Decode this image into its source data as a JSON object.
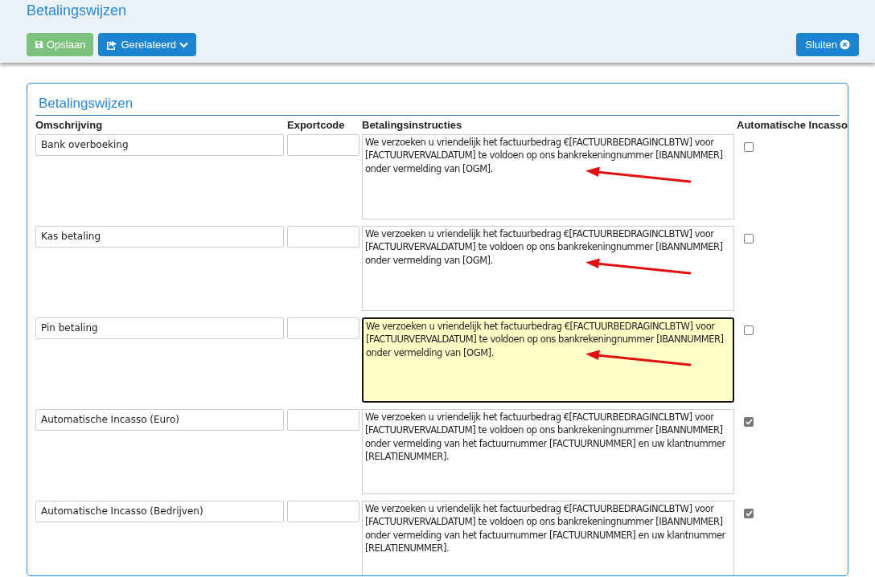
{
  "header": {
    "title": "Betalingswijzen",
    "buttons": [
      {
        "kind": "save",
        "label": "Opslaan",
        "disabled": true
      },
      {
        "kind": "related",
        "label": "Gerelateerd"
      }
    ],
    "close_button": {
      "label": "Sluiten"
    }
  },
  "panel": {
    "title": "Betalingswijzen",
    "columns": [
      "Omschrijving",
      "Exportcode",
      "Betalingsinstructies",
      "Automatische Incasso"
    ],
    "rows": [
      {
        "description": "Bank overboeking",
        "export_code": "",
        "instructions": "We verzoeken u vriendelijk het factuurbedrag €[FACTUURBEDRAGINCLBTW] voor [FACTUURVERVALDATUM] te voldoen op ons bankrekeningnummer [IBANNUMMER] onder vermelding van [OGM].",
        "focused": false,
        "checked": false,
        "arrow": true
      },
      {
        "description": "Kas betaling",
        "export_code": "",
        "instructions": "We verzoeken u vriendelijk het factuurbedrag €[FACTUURBEDRAGINCLBTW] voor [FACTUURVERVALDATUM] te voldoen op ons bankrekeningnummer [IBANNUMMER] onder vermelding van [OGM].",
        "focused": false,
        "checked": false,
        "arrow": true
      },
      {
        "description": "Pin betaling",
        "export_code": "",
        "instructions": "We verzoeken u vriendelijk het factuurbedrag €[FACTUURBEDRAGINCLBTW] voor [FACTUURVERVALDATUM] te voldoen op ons bankrekeningnummer [IBANNUMMER] onder vermelding van [OGM].",
        "focused": true,
        "checked": false,
        "arrow": true
      },
      {
        "description": "Automatische Incasso (Euro)",
        "export_code": "",
        "instructions": "We verzoeken u vriendelijk het factuurbedrag €[FACTUURBEDRAGINCLBTW] voor [FACTUURVERVALDATUM] te voldoen op ons bankrekeningnummer [IBANNUMMER] onder vermelding van het factuurnummer [FACTUURNUMMER] en uw klantnummer [RELATIENUMMER].",
        "focused": false,
        "checked": true,
        "arrow": false
      },
      {
        "description": "Automatische Incasso (Bedrijven)",
        "export_code": "",
        "instructions": "We verzoeken u vriendelijk het factuurbedrag €[FACTUURBEDRAGINCLBTW] voor [FACTUURVERVALDATUM] te voldoen op ons bankrekeningnummer [IBANNUMMER] onder vermelding van het factuurnummer [FACTUURNUMMER] en uw klantnummer [RELATIENUMMER].",
        "focused": false,
        "checked": true,
        "arrow": false
      }
    ]
  }
}
